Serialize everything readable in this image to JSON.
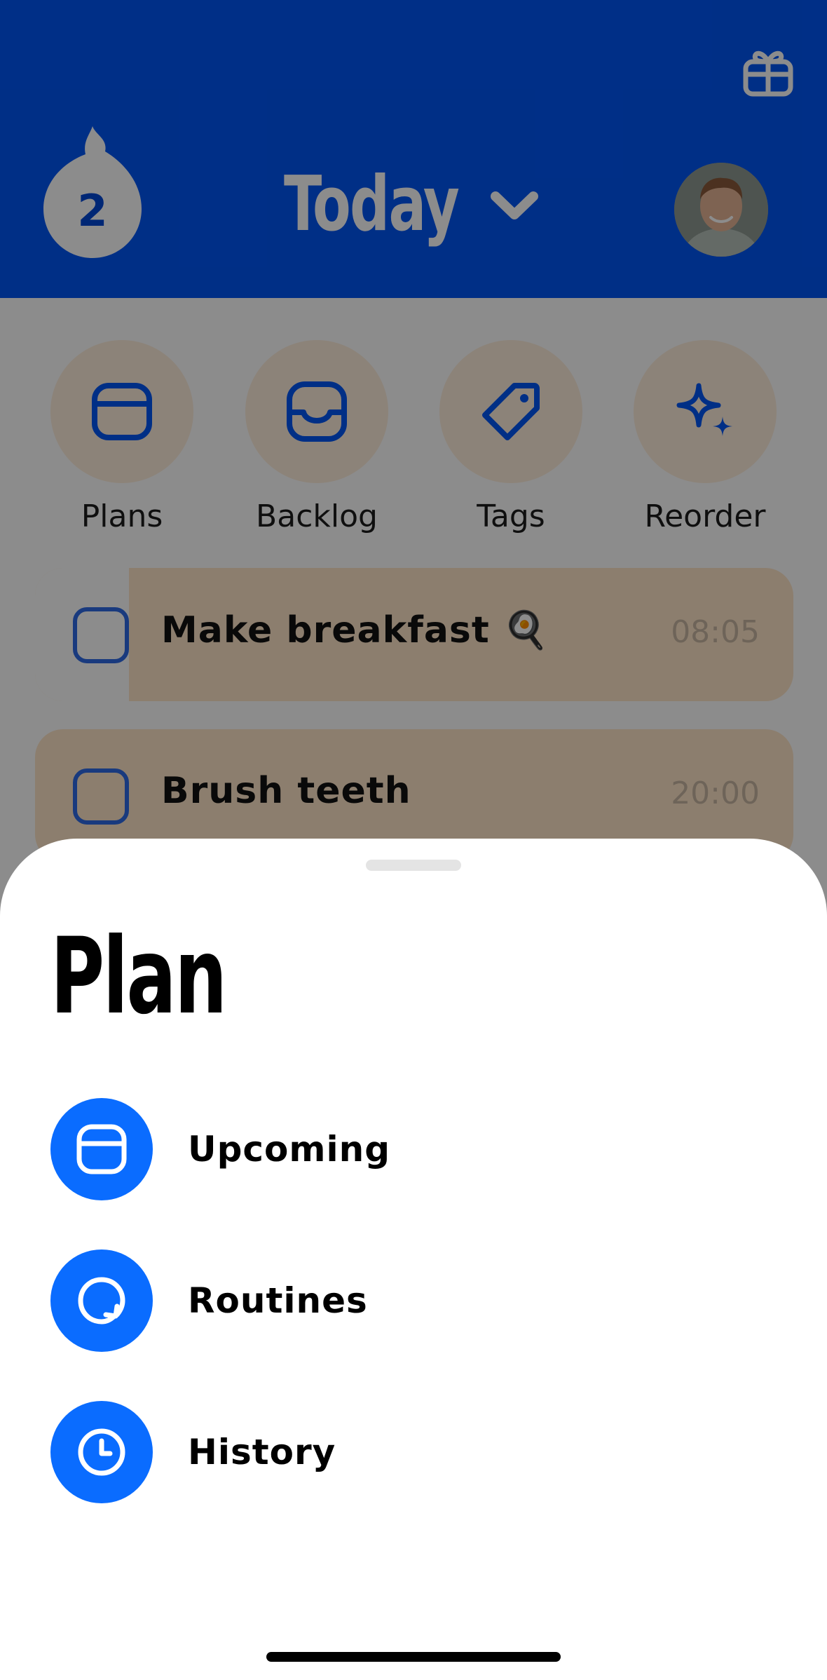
{
  "header": {
    "streak_count": "2",
    "title": "Today",
    "icons": {
      "gift": "gift-icon",
      "streak": "flame-drop-icon",
      "dropdown": "chevron-down-icon"
    }
  },
  "quick_actions": [
    {
      "label": "Plans",
      "icon": "calendar-card-icon"
    },
    {
      "label": "Backlog",
      "icon": "inbox-tray-icon"
    },
    {
      "label": "Tags",
      "icon": "tag-icon"
    },
    {
      "label": "Reorder",
      "icon": "sparkles-icon"
    }
  ],
  "tasks": [
    {
      "name": "Make breakfast 🍳",
      "time": "08:05"
    },
    {
      "name": "Brush teeth",
      "time": "20:00"
    }
  ],
  "sheet": {
    "title": "Plan",
    "items": [
      {
        "label": "Upcoming",
        "icon": "card-icon"
      },
      {
        "label": "Routines",
        "icon": "repeat-icon"
      },
      {
        "label": "History",
        "icon": "clock-icon"
      }
    ]
  },
  "colors": {
    "header_bg": "#0056f5",
    "accent_blue": "#0a6cff",
    "action_circle": "#ffeedd",
    "task_card": "#ffe6c8",
    "overlay": "rgba(0,0,0,0.45)"
  }
}
